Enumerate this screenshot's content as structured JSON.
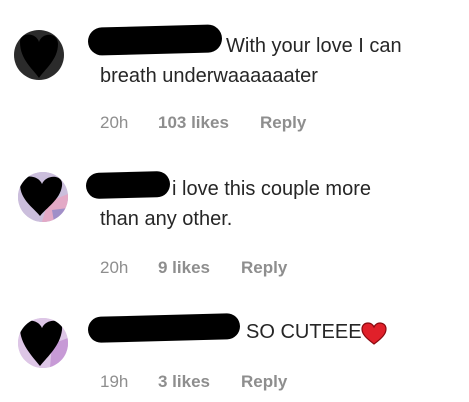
{
  "comments": [
    {
      "text_line1": "With your love I can",
      "text_line2": "breath underwaaaaaater",
      "time": "20h",
      "likes": "103 likes",
      "reply": "Reply",
      "avatar_icon": "user-avatar-redacted"
    },
    {
      "text_line1": "i love this couple more",
      "text_line2": "than any other.",
      "time": "20h",
      "likes": "9 likes",
      "reply": "Reply",
      "avatar_icon": "user-avatar-redacted"
    },
    {
      "text_line1": "SO CUTEEE",
      "time": "19h",
      "likes": "3 likes",
      "reply": "Reply",
      "avatar_icon": "user-avatar-redacted",
      "emoji": "red-heart-icon"
    }
  ],
  "colors": {
    "text": "#262626",
    "meta": "#8e8e8e",
    "heart": "#e0202a"
  }
}
